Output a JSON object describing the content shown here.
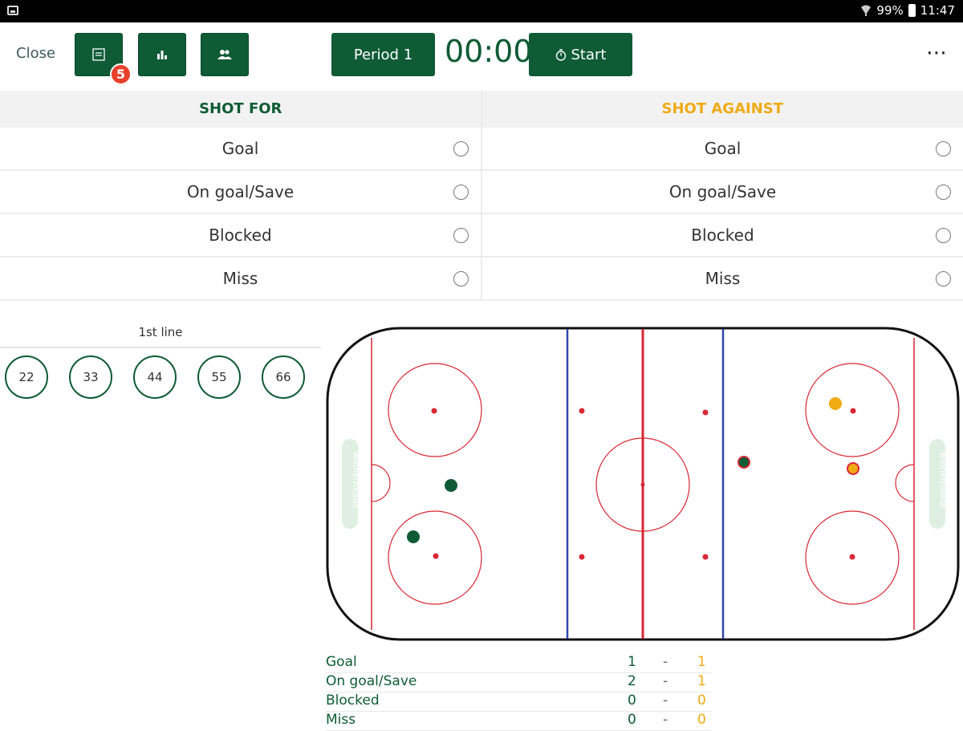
{
  "status_bar": {
    "battery": "99%",
    "time": "11:47"
  },
  "toolbar": {
    "close_label": "Close",
    "badge_count": "5",
    "period_label": "Period 1",
    "timer": "00:00",
    "start_label": "Start",
    "more_label": "⋯"
  },
  "shot_table": {
    "for_header": "SHOT FOR",
    "against_header": "SHOT AGAINST",
    "rows": [
      {
        "left": "Goal",
        "right": "Goal"
      },
      {
        "left": "On goal/Save",
        "right": "On goal/Save"
      },
      {
        "left": "Blocked",
        "right": "Blocked"
      },
      {
        "left": "Miss",
        "right": "Miss"
      }
    ]
  },
  "lineup": {
    "title": "1st line",
    "players": [
      "22",
      "33",
      "44",
      "55",
      "66"
    ]
  },
  "rink": {
    "watermark": "winnerheads",
    "colors": {
      "for": "#0e5b36",
      "against": "#f0aa14",
      "red_line": "#d92633",
      "blue_line": "#3346b0"
    }
  },
  "summary": {
    "rows": [
      {
        "label": "Goal",
        "for": "1",
        "sep": "-",
        "against": "1"
      },
      {
        "label": "On goal/Save",
        "for": "2",
        "sep": "-",
        "against": "1"
      },
      {
        "label": "Blocked",
        "for": "0",
        "sep": "-",
        "against": "0"
      },
      {
        "label": "Miss",
        "for": "0",
        "sep": "-",
        "against": "0"
      }
    ]
  }
}
